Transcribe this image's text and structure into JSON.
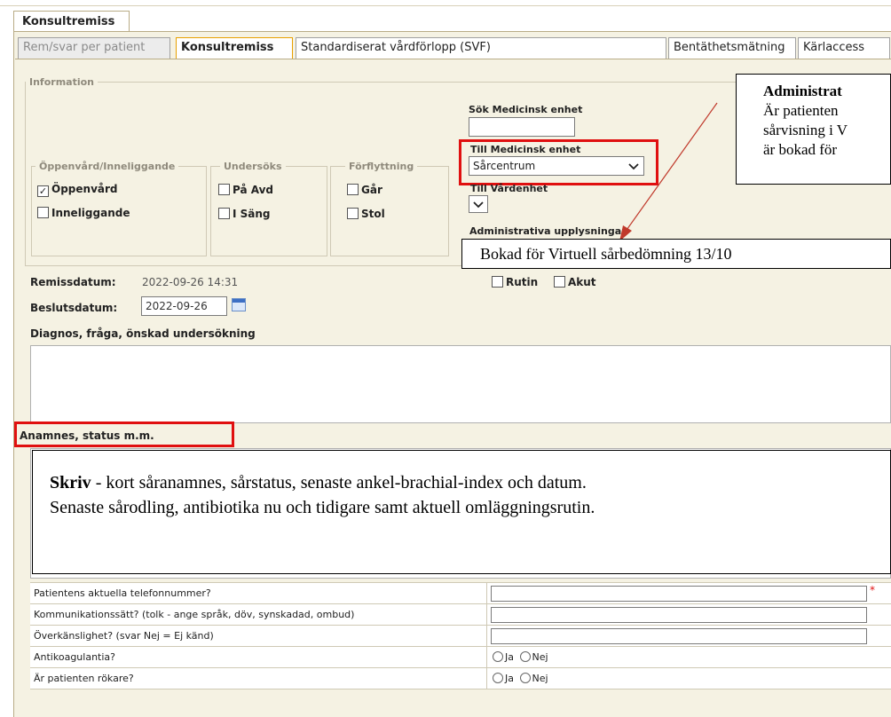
{
  "window": {
    "outer_tab": "Konsultremiss"
  },
  "tabs": [
    {
      "label": "Rem/svar per patient",
      "state": "disabled"
    },
    {
      "label": "Konsultremiss",
      "state": "active"
    },
    {
      "label": "Standardiserat vårdförlopp (SVF)",
      "state": "normal"
    },
    {
      "label": "Bentäthetsmätning",
      "state": "normal"
    },
    {
      "label": "Kärlaccess",
      "state": "normal"
    }
  ],
  "information": {
    "legend": "Information",
    "oppenvard": {
      "legend": "Öppenvård/Inneliggande",
      "options": [
        {
          "label": "Öppenvård",
          "checked": true
        },
        {
          "label": "Inneliggande",
          "checked": false
        }
      ]
    },
    "undersoks": {
      "legend": "Undersöks",
      "options": [
        {
          "label": "På Avd",
          "checked": false
        },
        {
          "label": "I Säng",
          "checked": false
        }
      ]
    },
    "forflyttning": {
      "legend": "Förflyttning",
      "options": [
        {
          "label": "Går",
          "checked": false
        },
        {
          "label": "Stol",
          "checked": false
        }
      ]
    },
    "sok_label": "Sök Medicinsk enhet",
    "sok_value": "",
    "till_med_label": "Till Medicinsk enhet",
    "till_med_value": "Sårcentrum",
    "till_vard_label": "Till Vårdenhet",
    "till_vard_value": "",
    "adm_label": "Administrativa upplysningar"
  },
  "callouts": {
    "top_title": "Administrat",
    "top_line1": "Är patienten",
    "top_line2": "sårvisning i V",
    "top_line3": "är bokad för",
    "booked": "Bokad för Virtuell sårbedömning 13/10",
    "skriv_bold": "Skriv",
    "skriv_line1": " - kort såranamnes, sårstatus, senaste ankel-brachial-index och datum.",
    "skriv_line2": "Senaste sårodling, antibiotika nu och tidigare samt aktuell omläggningsrutin."
  },
  "dates": {
    "remiss_label": "Remissdatum:",
    "remiss_value": "2022-09-26 14:31",
    "beslut_label": "Beslutsdatum:",
    "beslut_value": "2022-09-26"
  },
  "priority": [
    {
      "label": "Rutin",
      "checked": false
    },
    {
      "label": "Akut",
      "checked": false
    }
  ],
  "diagnos_label": "Diagnos, fråga, önskad undersökning",
  "anamnes_label": "Anamnes, status m.m.",
  "questions": [
    {
      "q": "Patientens aktuella telefonnummer?",
      "type": "text",
      "required": "*"
    },
    {
      "q": "Kommunikationssätt? (tolk - ange språk, döv, synskadad, ombud)",
      "type": "text"
    },
    {
      "q": "Överkänslighet? (svar Nej = Ej känd)",
      "type": "text"
    },
    {
      "q": "Antikoagulantia?",
      "type": "radio",
      "options": [
        "Ja",
        "Nej"
      ]
    },
    {
      "q": "Är patienten rökare?",
      "type": "radio",
      "options": [
        "Ja",
        "Nej"
      ]
    }
  ],
  "colors": {
    "panel": "#f5f2e3",
    "highlight": "#e01010",
    "arrow": "#c0392b",
    "active_tab_border": "#e8a000"
  }
}
